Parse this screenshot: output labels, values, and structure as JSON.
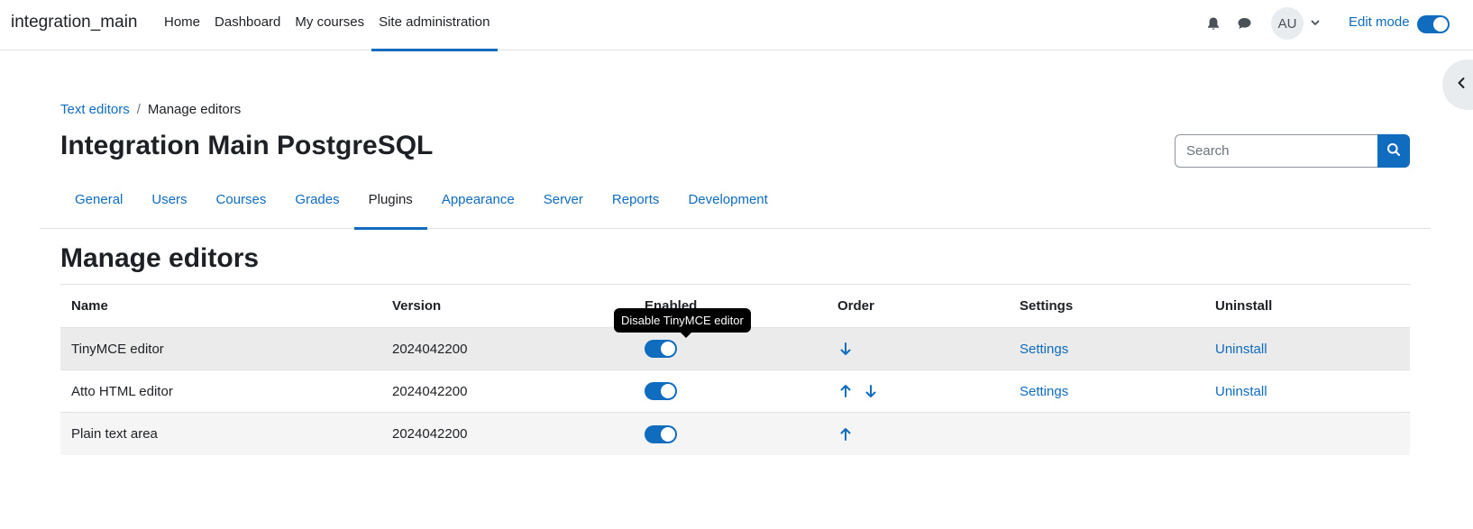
{
  "navbar": {
    "brand": "integration_main",
    "items": [
      {
        "label": "Home",
        "active": false
      },
      {
        "label": "Dashboard",
        "active": false
      },
      {
        "label": "My courses",
        "active": false
      },
      {
        "label": "Site administration",
        "active": true
      }
    ],
    "avatar_initials": "AU",
    "edit_mode_label": "Edit mode",
    "edit_mode_on": true,
    "icons": {
      "notifications": "bell-icon",
      "messages": "chat-bubble-icon",
      "user_menu": "chevron-down-icon"
    }
  },
  "drawer": {
    "icon": "chevron-left-icon"
  },
  "breadcrumb": {
    "parent": "Text editors",
    "separator": "/",
    "current": "Manage editors"
  },
  "header": {
    "title": "Integration Main PostgreSQL"
  },
  "search": {
    "placeholder": "Search",
    "value": "",
    "icon": "search-icon"
  },
  "tabs": [
    {
      "label": "General",
      "active": false
    },
    {
      "label": "Users",
      "active": false
    },
    {
      "label": "Courses",
      "active": false
    },
    {
      "label": "Grades",
      "active": false
    },
    {
      "label": "Plugins",
      "active": true
    },
    {
      "label": "Appearance",
      "active": false
    },
    {
      "label": "Server",
      "active": false
    },
    {
      "label": "Reports",
      "active": false
    },
    {
      "label": "Development",
      "active": false
    }
  ],
  "section": {
    "title": "Manage editors"
  },
  "table": {
    "columns": [
      "Name",
      "Version",
      "Enabled",
      "Order",
      "Settings",
      "Uninstall"
    ],
    "rows": [
      {
        "name": "TinyMCE editor",
        "version": "2024042200",
        "enabled": true,
        "order": [
          "down"
        ],
        "settings": "Settings",
        "uninstall": "Uninstall"
      },
      {
        "name": "Atto HTML editor",
        "version": "2024042200",
        "enabled": true,
        "order": [
          "up",
          "down"
        ],
        "settings": "Settings",
        "uninstall": "Uninstall"
      },
      {
        "name": "Plain text area",
        "version": "2024042200",
        "enabled": true,
        "order": [
          "up"
        ],
        "settings": "",
        "uninstall": ""
      }
    ]
  },
  "tooltip": {
    "text": "Disable TinyMCE editor"
  },
  "colors": {
    "accent": "#0f6cbf",
    "text": "#1d2125",
    "border": "#dee2e6",
    "hover_row": "#ebebeb",
    "striped_row": "#f5f5f5"
  }
}
